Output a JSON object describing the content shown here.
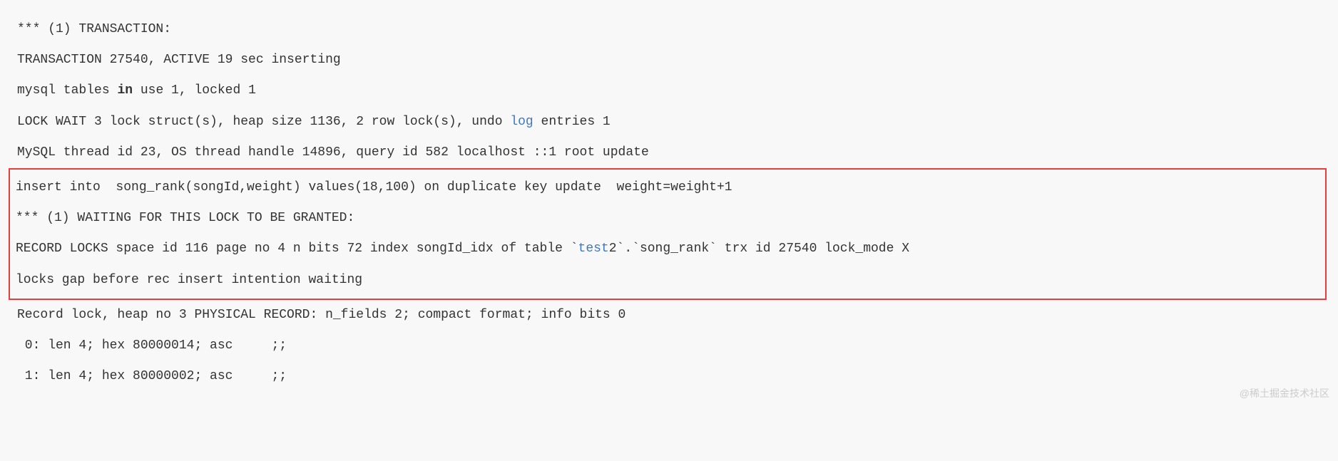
{
  "lines": {
    "l1_prefix": "*** (1) TRANSACTION:",
    "l2": "TRANSACTION 27540, ACTIVE 19 sec inserting",
    "l3_pre": "mysql tables ",
    "l3_in": "in",
    "l3_post": " use 1, locked 1",
    "l4_pre": "LOCK WAIT 3 lock struct(s), heap size 1136, 2 row lock(s), undo ",
    "l4_log": "log",
    "l4_post": " entries 1",
    "l5": "MySQL thread id 23, OS thread handle 14896, query id 582 localhost ::1 root update",
    "l6": "insert into  song_rank(songId,weight) values(18,100) on duplicate key update  weight=weight+1",
    "l7": "*** (1) WAITING FOR THIS LOCK TO BE GRANTED:",
    "l8_pre": "RECORD LOCKS space id 116 page no 4 n bits 72 index songId_idx of table `",
    "l8_test": "test",
    "l8_post": "2`.`song_rank` trx id 27540 lock_mode X",
    "l9": "locks gap before rec insert intention waiting",
    "l10": "Record lock, heap no 3 PHYSICAL RECORD: n_fields 2; compact format; info bits 0",
    "l11": " 0: len 4; hex 80000014; asc     ;;",
    "l12": " 1: len 4; hex 80000002; asc     ;;"
  },
  "watermark": "@稀土掘金技术社区"
}
